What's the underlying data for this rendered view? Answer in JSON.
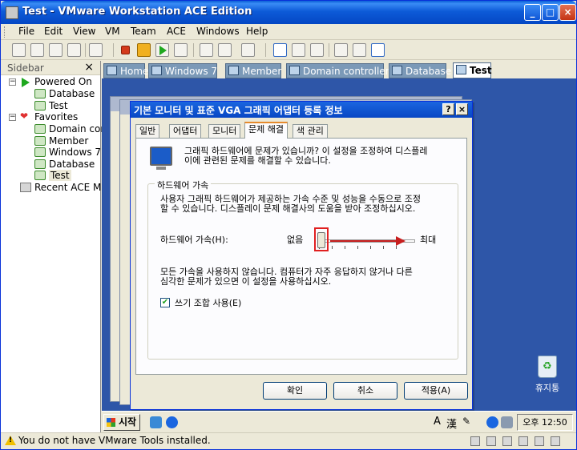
{
  "window": {
    "title": "Test - VMware Workstation ACE Edition"
  },
  "menu": [
    "File",
    "Edit",
    "View",
    "VM",
    "Team",
    "ACE",
    "Windows",
    "Help"
  ],
  "sidebar": {
    "title": "Sidebar",
    "items": [
      {
        "label": "Powered On",
        "icon": "play-icon"
      },
      {
        "label": "Database",
        "icon": "vm-icon"
      },
      {
        "label": "Test",
        "icon": "vm-icon"
      },
      {
        "label": "Favorites",
        "icon": "heart-icon"
      },
      {
        "label": "Domain cor",
        "icon": "vm-icon"
      },
      {
        "label": "Member",
        "icon": "vm-icon"
      },
      {
        "label": "Windows 7",
        "icon": "vm-icon"
      },
      {
        "label": "Database",
        "icon": "vm-icon"
      },
      {
        "label": "Test",
        "icon": "vm-icon"
      },
      {
        "label": "Recent ACE M",
        "icon": "recent-icon"
      }
    ]
  },
  "tabs": [
    {
      "label": "Home"
    },
    {
      "label": "Windows 7"
    },
    {
      "label": "Member"
    },
    {
      "label": "Domain controller"
    },
    {
      "label": "Database"
    },
    {
      "label": "Test",
      "active": true
    }
  ],
  "dialog": {
    "title": "기본 모니터 및 표준 VGA 그래픽 어댑터 등록 정보",
    "tabs": [
      "일반",
      "어댑터",
      "모니터",
      "문제 해결",
      "색 관리"
    ],
    "active_tab": "문제 해결",
    "intro": "그래픽 하드웨어에 문제가 있습니까? 이 설정을 조정하여 디스플레\n이에 관련된 문제를 해결할 수 있습니다.",
    "group_label": "하드웨어 가속",
    "group_desc": "사용자 그래픽 하드웨어가 제공하는 가속 수준 및 성능을 수동으로 조정\n할 수 있습니다. 디스플레이 문제 해결사의 도움을 받아 조정하십시오.",
    "accel_label": "하드웨어 가속(H):",
    "slider_min": "없음",
    "slider_max": "최대",
    "slider_value": 0,
    "warning": "모든 가속을 사용하지 않습니다. 컴퓨터가 자주 응답하지 않거나 다른\n심각한 문제가 있으면 이 설정을 사용하십시오.",
    "checkbox_label": "쓰기 조합 사용(E)",
    "checkbox_checked": true,
    "buttons": {
      "ok": "확인",
      "cancel": "취소",
      "apply": "적용(A)"
    }
  },
  "desktop": {
    "recycle_bin": "휴지통"
  },
  "guest_taskbar": {
    "start": "시작",
    "clock": "오후 12:50"
  },
  "status": {
    "message": "You do not have VMware Tools installed."
  }
}
